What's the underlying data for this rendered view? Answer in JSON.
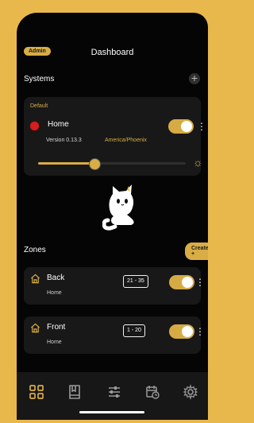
{
  "header": {
    "badge": "Admin",
    "title": "Dashboard"
  },
  "systems": {
    "section_title": "Systems",
    "add_icon": "plus-icon",
    "card": {
      "default_label": "Default",
      "name": "Home",
      "version": "Version 0.13.3",
      "timezone": "America/Phoenix",
      "enabled": true,
      "brightness_level": 0.38,
      "icons": {
        "status": "red-record-icon",
        "brightness": "sun-icon"
      }
    }
  },
  "zones": {
    "section_title": "Zones",
    "create_label": "Create +",
    "items": [
      {
        "name": "Back",
        "system": "Home",
        "range": "21 - 35",
        "enabled": true
      },
      {
        "name": "Front",
        "system": "Home",
        "range": "1 - 20",
        "enabled": true
      }
    ]
  },
  "tabbar": [
    {
      "name": "dashboard",
      "icon": "grid-icon",
      "active": true
    },
    {
      "name": "presets",
      "icon": "book-icon",
      "active": false
    },
    {
      "name": "controls",
      "icon": "sliders-icon",
      "active": false
    },
    {
      "name": "schedule",
      "icon": "calendar-clock-icon",
      "active": false
    },
    {
      "name": "settings",
      "icon": "gear-icon",
      "active": false
    }
  ],
  "colors": {
    "accent": "#d8ad45",
    "background": "#050505",
    "card": "#181818",
    "frame": "#e9b84d"
  }
}
